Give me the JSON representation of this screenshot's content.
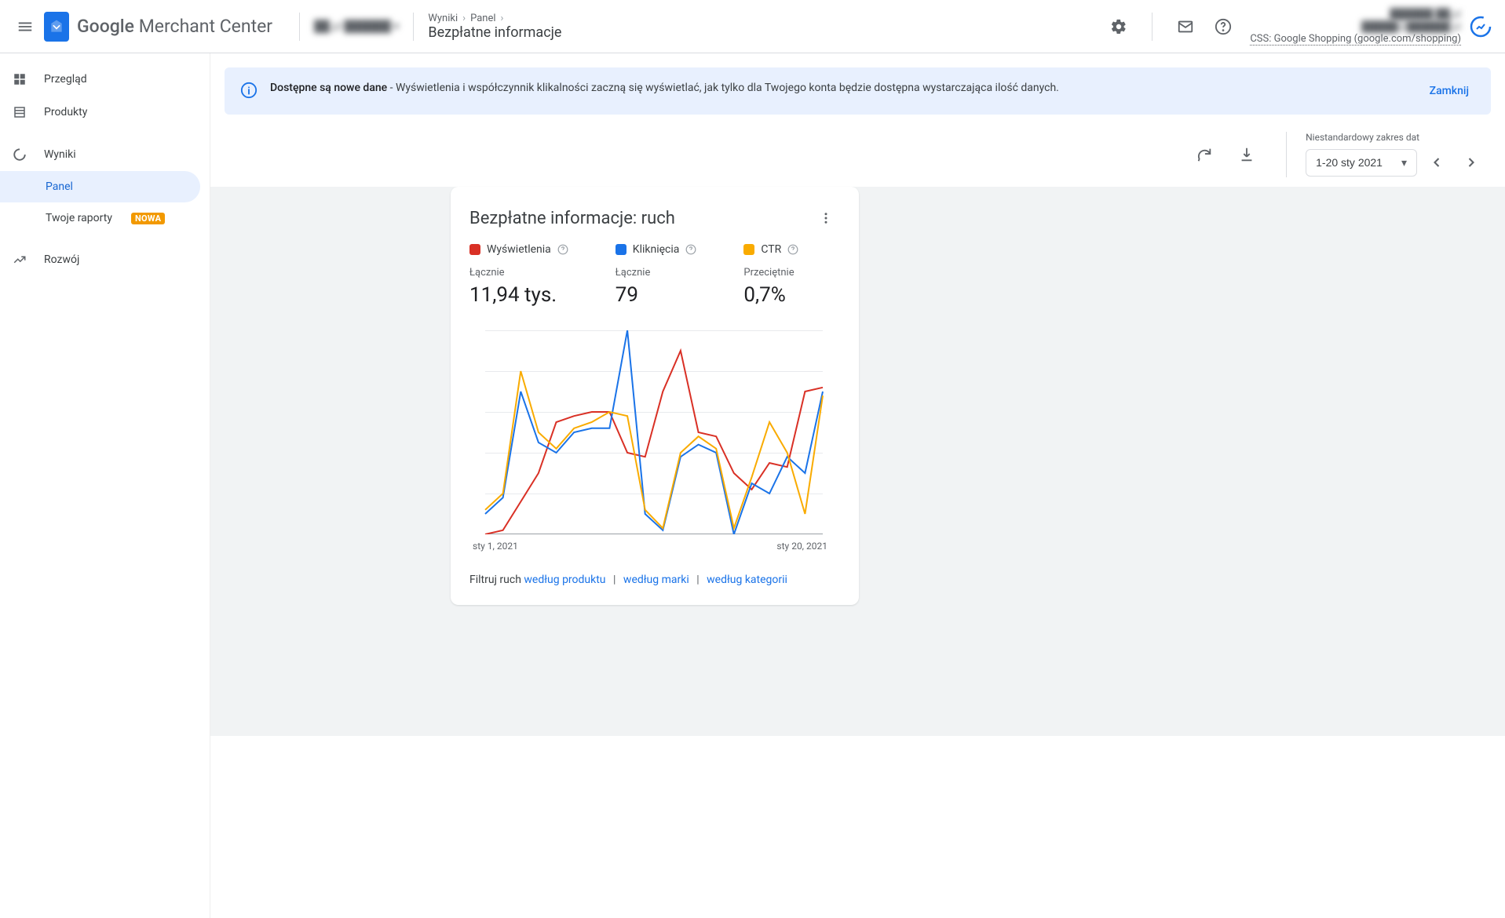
{
  "header": {
    "app_name_1": "Google",
    "app_name_2": " Merchant Center",
    "account_selector_blurred": "██.pl ██████ ▾",
    "breadcrumb": {
      "a": "Wyniki",
      "b": "Panel"
    },
    "page_title": "Bezpłatne informacje",
    "account_blurred_1": "██████ ██.pl",
    "account_blurred_2": "█████@██████.pl",
    "css_line": "CSS: Google Shopping (google.com/shopping)"
  },
  "sidebar": {
    "overview": "Przegląd",
    "products": "Produkty",
    "results": "Wyniki",
    "panel": "Panel",
    "reports": "Twoje raporty",
    "reports_badge": "NOWA",
    "growth": "Rozwój"
  },
  "banner": {
    "bold": "Dostępne są nowe dane",
    "text": " - Wyświetlenia i współczynnik klikalności zaczną się wyświetlać, jak tylko dla Twojego konta będzie dostępna wystarczająca ilość danych.",
    "close": "Zamknij"
  },
  "toolbar": {
    "date_label": "Niestandardowy zakres dat",
    "date_value": "1-20 sty 2021"
  },
  "card": {
    "title": "Bezpłatne informacje: ruch",
    "m1": {
      "name": "Wyświetlenia",
      "sub": "Łącznie",
      "val": "11,94 tys."
    },
    "m2": {
      "name": "Kliknięcia",
      "sub": "Łącznie",
      "val": "79"
    },
    "m3": {
      "name": "CTR",
      "sub": "Przeciętnie",
      "val": "0,7%"
    },
    "xstart": "sty 1, 2021",
    "xend": "sty 20, 2021",
    "filter_label": "Filtruj ruch ",
    "filter_product": "według produktu",
    "filter_brand": "według marki",
    "filter_category": "według kategorii"
  },
  "chart_data": {
    "type": "line",
    "x_start": "sty 1, 2021",
    "x_end": "sty 20, 2021",
    "n_points": 20,
    "ylim": [
      0,
      100
    ],
    "series": [
      {
        "name": "Wyświetlenia",
        "color": "#d93025",
        "values": [
          0,
          2,
          16,
          30,
          55,
          58,
          60,
          60,
          40,
          38,
          70,
          90,
          50,
          48,
          30,
          22,
          35,
          33,
          70,
          72
        ]
      },
      {
        "name": "Kliknięcia",
        "color": "#1a73e8",
        "values": [
          10,
          18,
          70,
          45,
          40,
          50,
          52,
          52,
          100,
          10,
          2,
          38,
          44,
          40,
          0,
          25,
          20,
          38,
          30,
          70
        ]
      },
      {
        "name": "CTR",
        "color": "#f9ab00",
        "values": [
          12,
          20,
          80,
          50,
          42,
          52,
          55,
          60,
          58,
          12,
          3,
          40,
          48,
          42,
          3,
          28,
          55,
          40,
          10,
          68
        ]
      }
    ]
  }
}
